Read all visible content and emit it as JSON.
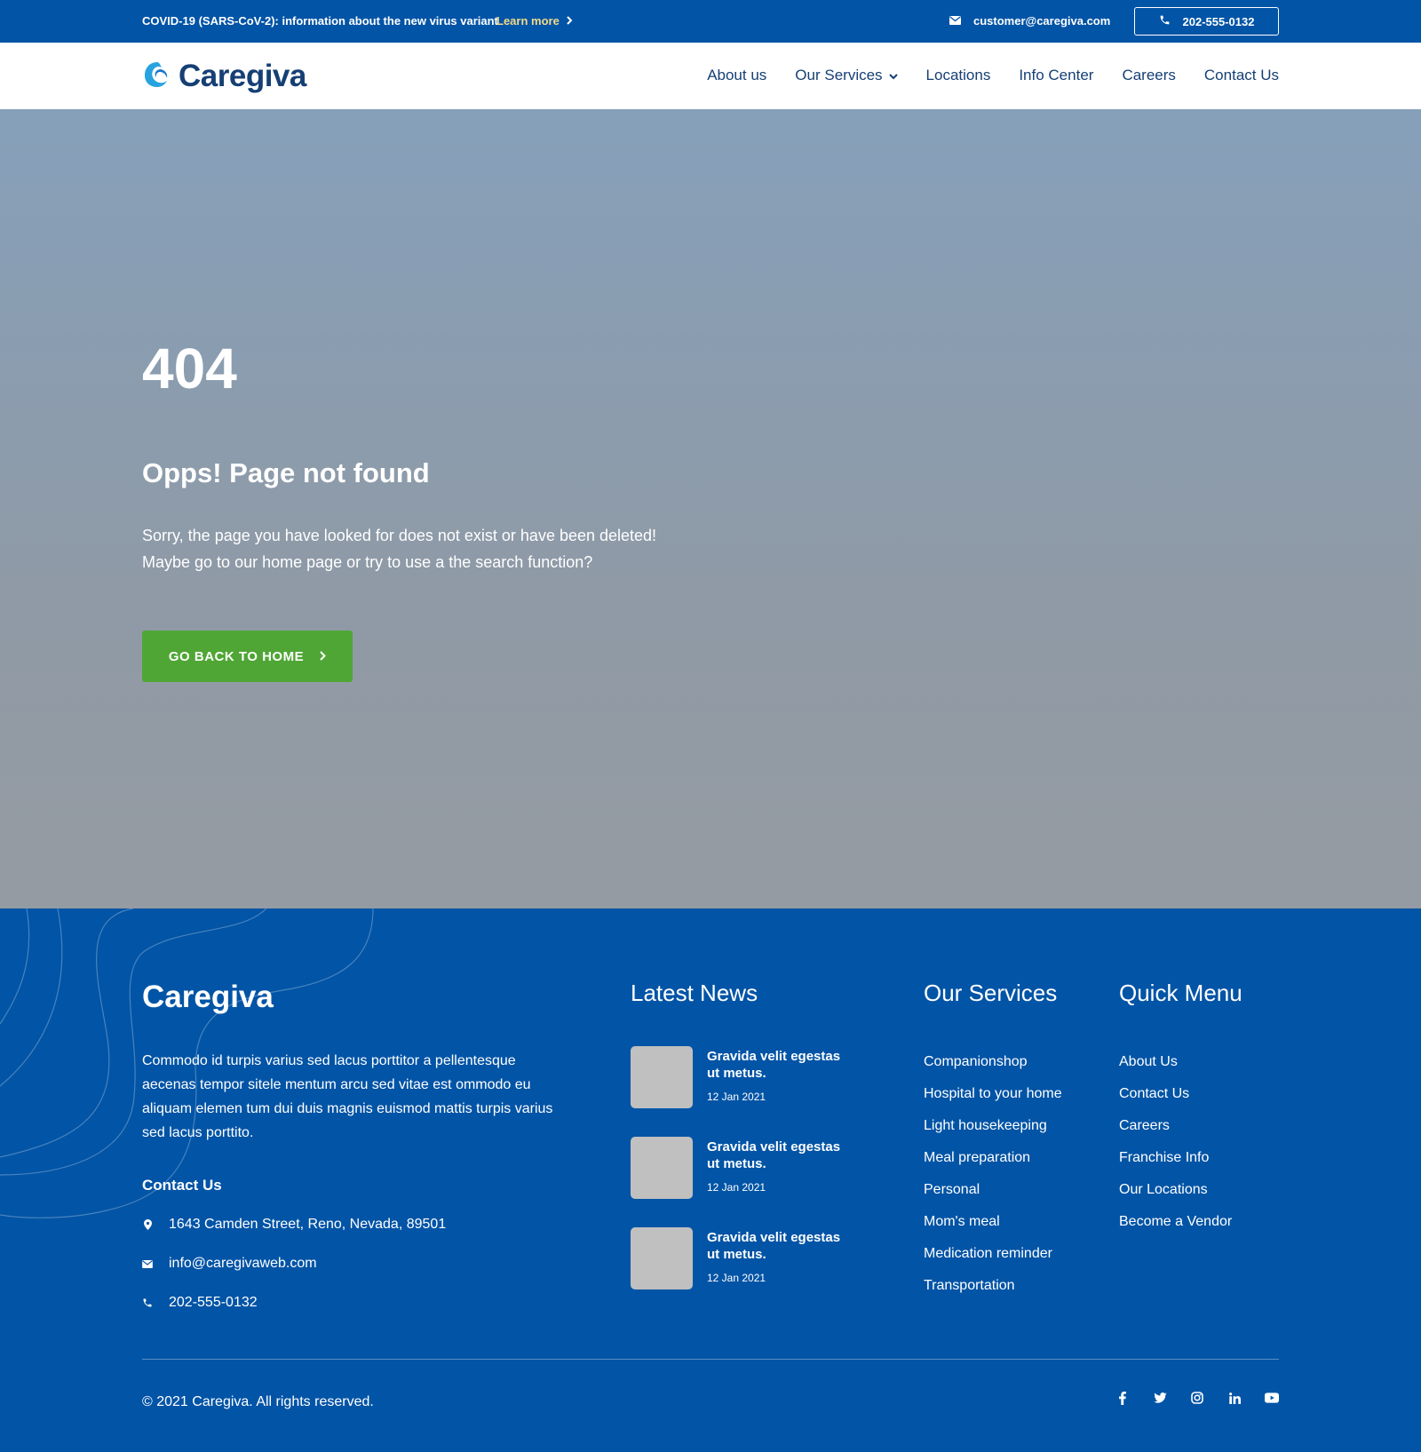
{
  "topbar": {
    "notice": "COVID-19 (SARS-CoV-2): information about the new virus variant",
    "learn_more": "Learn more",
    "email": "customer@caregiva.com",
    "phone": "202-555-0132"
  },
  "header": {
    "logo_text": "Caregiva",
    "nav": [
      "About us",
      "Our Services",
      "Locations",
      "Info Center",
      "Careers",
      "Contact Us"
    ]
  },
  "hero": {
    "code": "404",
    "title": "Opps! Page not found",
    "line1": "Sorry, the page you have looked for does not exist or have been deleted!",
    "line2": "Maybe go to our home page or try to use a the search function?",
    "button": "GO BACK TO HOME"
  },
  "footer": {
    "brand": "Caregiva",
    "description": "Commodo id turpis varius sed lacus porttitor a pellentesque aecenas tempor sitele mentum arcu sed vitae est ommodo eu aliquam elemen tum dui duis magnis euismod mattis turpis varius sed lacus porttito.",
    "contact_title": "Contact Us",
    "address": "1643  Camden Street, Reno, Nevada, 89501",
    "email": "info@caregivaweb.com",
    "phone": "202-555-0132",
    "news_title": "Latest News",
    "news": [
      {
        "title": "Gravida velit egestas ut metus.",
        "date": "12 Jan 2021"
      },
      {
        "title": "Gravida velit egestas ut metus.",
        "date": "12 Jan 2021"
      },
      {
        "title": "Gravida velit egestas ut metus.",
        "date": "12 Jan 2021"
      }
    ],
    "services_title": "Our Services",
    "services": [
      "Companionshop",
      "Hospital to your home",
      "Light housekeeping",
      "Meal preparation",
      "Personal",
      "Mom's meal",
      "Medication reminder",
      "Transportation"
    ],
    "quick_title": "Quick Menu",
    "quick": [
      "About Us",
      "Contact Us",
      "Careers",
      "Franchise Info",
      "Our Locations",
      "Become a Vendor"
    ],
    "copyright": "© 2021 Caregiva. All rights reserved.",
    "social_icons": [
      "facebook-icon",
      "twitter-icon",
      "instagram-icon",
      "linkedin-icon",
      "youtube-icon"
    ]
  },
  "colors": {
    "primary": "#0254a6",
    "brand_text": "#163f74",
    "accent_green": "#4fa634",
    "learn_more": "#f2d98a"
  }
}
